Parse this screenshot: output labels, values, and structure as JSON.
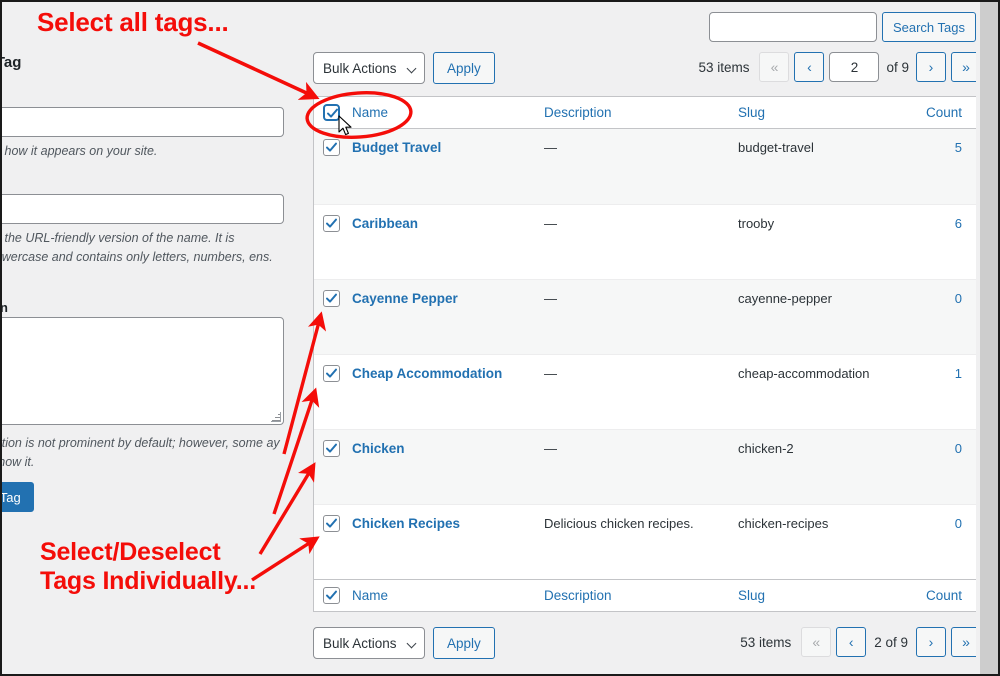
{
  "annotations": {
    "top": "Select all tags...",
    "bottom": "Select/Deselect\nTags Individually...",
    "color": "#f40d09"
  },
  "left_panel": {
    "heading": "w Tag",
    "name_help": "is how it appears on your site.",
    "slug_help": "is the URL-friendly version of the name. It is\nlowercase and contains only letters, numbers,\nens.",
    "description_label": "on",
    "description_help": "iption is not prominent by default; however, some\nay show it.",
    "submit_label": "w Tag",
    "name_value": "",
    "slug_value": "",
    "description_value": ""
  },
  "search": {
    "value": "",
    "placeholder": "",
    "button_label": "Search Tags"
  },
  "toolbar_top": {
    "bulk_actions_label": "Bulk Actions",
    "apply_label": "Apply",
    "items_count": "53 items",
    "first_label": "«",
    "prev_label": "‹",
    "page_value": "2",
    "of_label": "of 9",
    "next_label": "›",
    "last_label": "»"
  },
  "toolbar_bottom": {
    "bulk_actions_label": "Bulk Actions",
    "apply_label": "Apply",
    "items_count": "53 items",
    "first_label": "«",
    "prev_label": "‹",
    "page_static": "2 of 9",
    "next_label": "›",
    "last_label": "»"
  },
  "table": {
    "columns": {
      "name": "Name",
      "description": "Description",
      "slug": "Slug",
      "count": "Count"
    },
    "select_all_checked": true,
    "rows": [
      {
        "name": "Budget Travel",
        "description": "—",
        "slug": "budget-travel",
        "count": "5",
        "checked": true
      },
      {
        "name": "Caribbean",
        "description": "—",
        "slug": "trooby",
        "count": "6",
        "checked": true
      },
      {
        "name": "Cayenne Pepper",
        "description": "—",
        "slug": "cayenne-pepper",
        "count": "0",
        "checked": true
      },
      {
        "name": "Cheap Accommodation",
        "description": "—",
        "slug": "cheap-accommodation",
        "count": "1",
        "checked": true
      },
      {
        "name": "Chicken",
        "description": "—",
        "slug": "chicken-2",
        "count": "0",
        "checked": true
      },
      {
        "name": "Chicken Recipes",
        "description": "Delicious chicken recipes.",
        "slug": "chicken-recipes",
        "count": "0",
        "checked": true
      }
    ]
  },
  "colors": {
    "link": "#2271b1",
    "annotation": "#f40d09",
    "page_bg": "#f0f0f1",
    "row_alt": "#f6f7f7"
  }
}
